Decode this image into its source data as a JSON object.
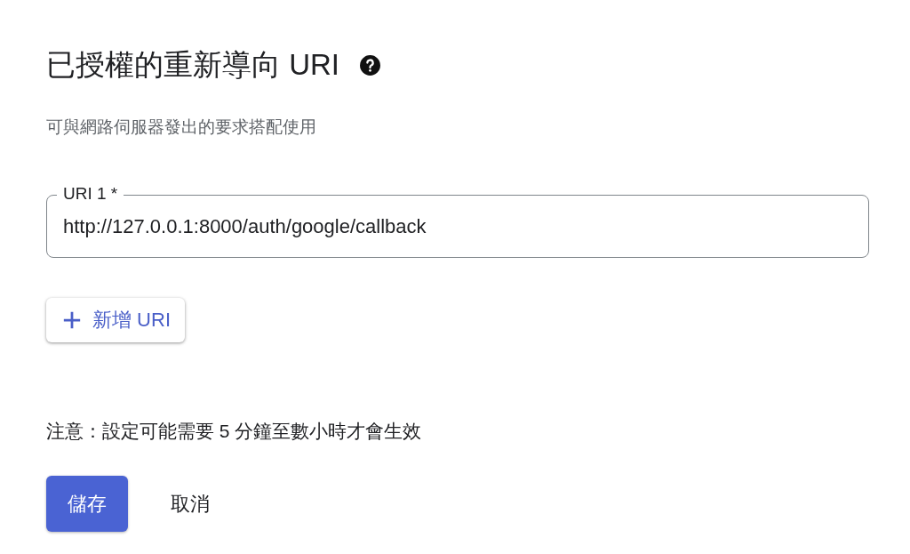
{
  "title": "已授權的重新導向 URI",
  "subtitle": "可與網路伺服器發出的要求搭配使用",
  "uri_fields": [
    {
      "label": "URI 1 *",
      "value": "http://127.0.0.1:8000/auth/google/callback"
    }
  ],
  "add_button": {
    "label": "新增 URI"
  },
  "note": "注意：設定可能需要 5 分鐘至數小時才會生效",
  "buttons": [
    {
      "kind": "primary",
      "label": "儲存"
    },
    {
      "kind": "text",
      "label": "取消"
    }
  ]
}
